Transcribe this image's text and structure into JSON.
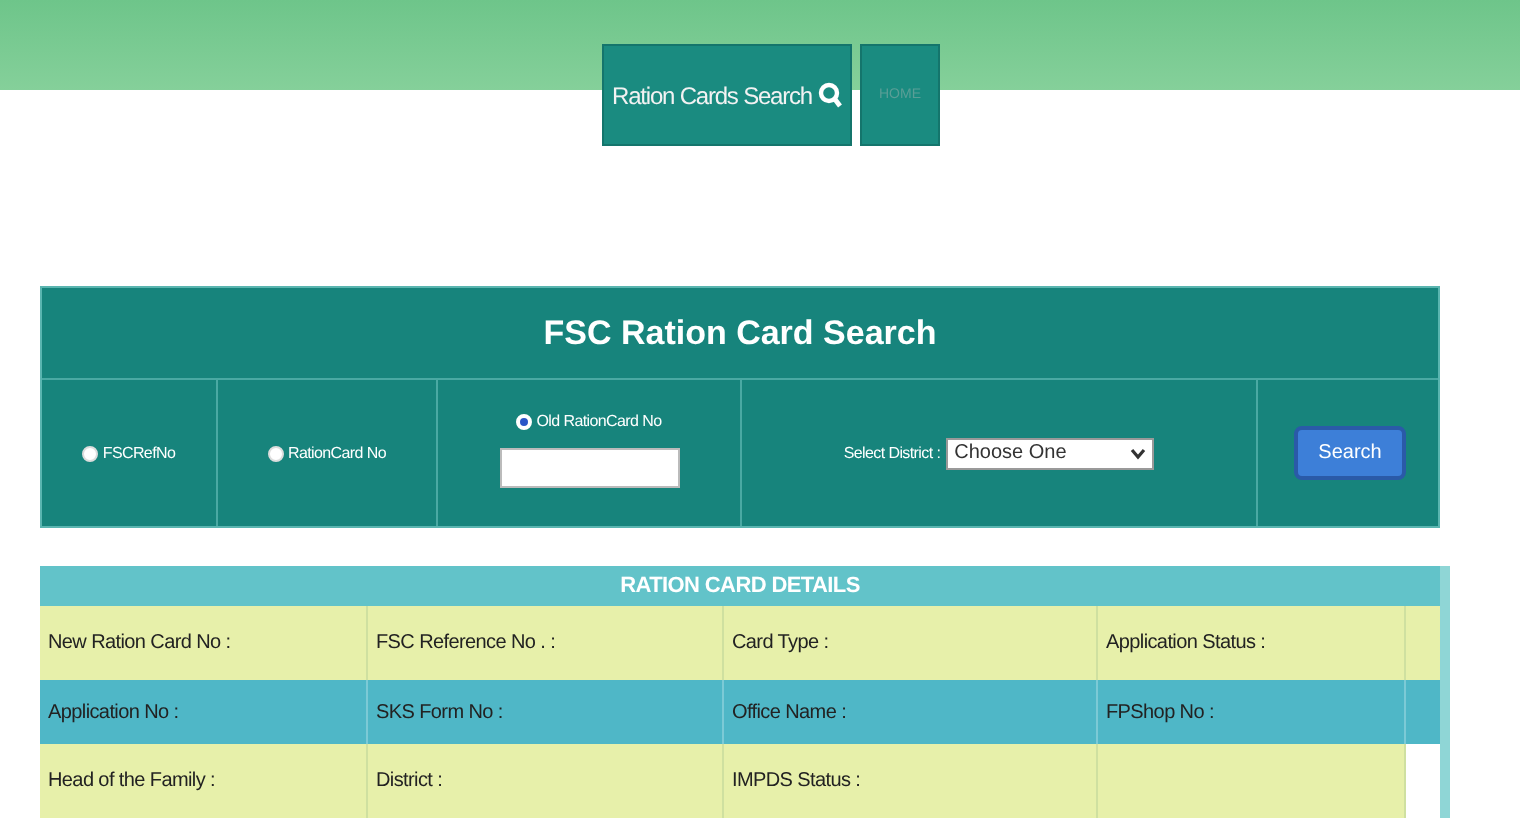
{
  "nav": [
    {
      "label": "Ration Cards Search",
      "icon": true
    },
    {
      "label": "HOME",
      "icon": false
    }
  ],
  "search_panel": {
    "title": "FSC Ration Card Search",
    "options": [
      {
        "label": "FSCRefNo",
        "selected": false
      },
      {
        "label": "RationCard No",
        "selected": false
      },
      {
        "label": "Old RationCard No",
        "selected": true
      }
    ],
    "district_label": "Select District :",
    "district_value": "Choose One",
    "button": "Search"
  },
  "details": {
    "title": "RATION CARD DETAILS",
    "rows": [
      [
        "New Ration Card No :",
        "FSC Reference No . :",
        "Card Type :",
        "Application Status :"
      ],
      [
        "Application No :",
        "SKS Form No :",
        "Office Name :",
        "FPShop No :"
      ],
      [
        "Head of the Family :",
        "District :",
        "IMPDS Status :"
      ]
    ]
  }
}
